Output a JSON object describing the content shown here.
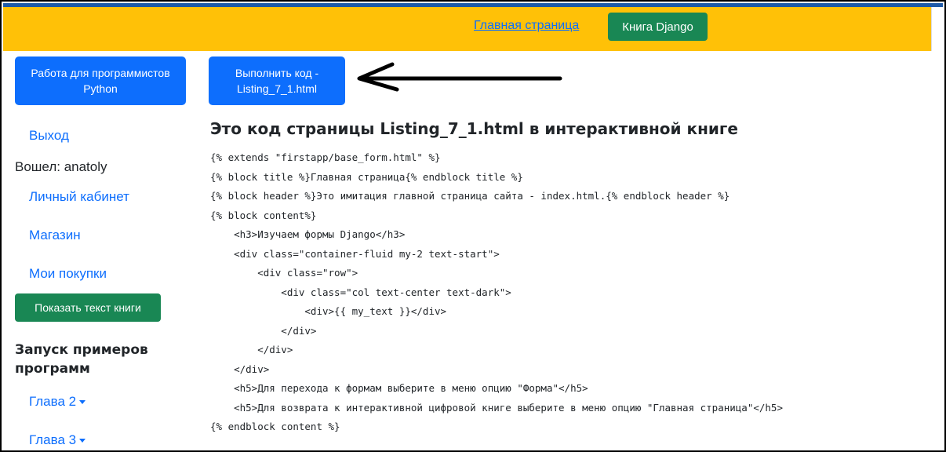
{
  "header": {
    "home_link": "Главная страница",
    "book_button": "Книга Django"
  },
  "sidebar": {
    "work_button": "Работа для программистов Python",
    "logout": "Выход",
    "logged_in": "Вошел: anatoly",
    "cabinet": "Личный кабинет",
    "shop": "Магазин",
    "purchases": "Мои покупки",
    "show_book_button": "Показать текст книги",
    "run_examples_heading": "Запуск примеров программ",
    "chapters": [
      "Глава 2",
      "Глава 3"
    ]
  },
  "main": {
    "run_button": "Выполнить код - Listing_7_1.html",
    "title": "Это код страницы Listing_7_1.html в интерактивной книге",
    "code_lines": [
      "{% extends \"firstapp/base_form.html\" %}",
      "{% block title %}Главная страница{% endblock title %}",
      "{% block header %}Это имитация главной страница сайта - index.html.{% endblock header %}",
      "{% block content%}",
      "    <h3>Изучаем формы Django</h3>",
      "    <div class=\"container-fluid my-2 text-start\">",
      "        <div class=\"row\">",
      "            <div class=\"col text-center text-dark\">",
      "                <div>{{ my_text }}</div>",
      "            </div>",
      "        </div>",
      "    </div>",
      "    <h5>Для перехода к формам выберите в меню опцию \"Форма\"</h5>",
      "    <h5>Для возврата к интерактивной цифровой книге выберите в меню опцию \"Главная страница\"</h5>",
      "{% endblock content %}"
    ]
  },
  "icons": {
    "arrow": "left-arrow-icon",
    "caret": "caret-down-icon"
  },
  "colors": {
    "header_bg": "#ffc107",
    "primary": "#0d6efd",
    "success": "#198754"
  }
}
